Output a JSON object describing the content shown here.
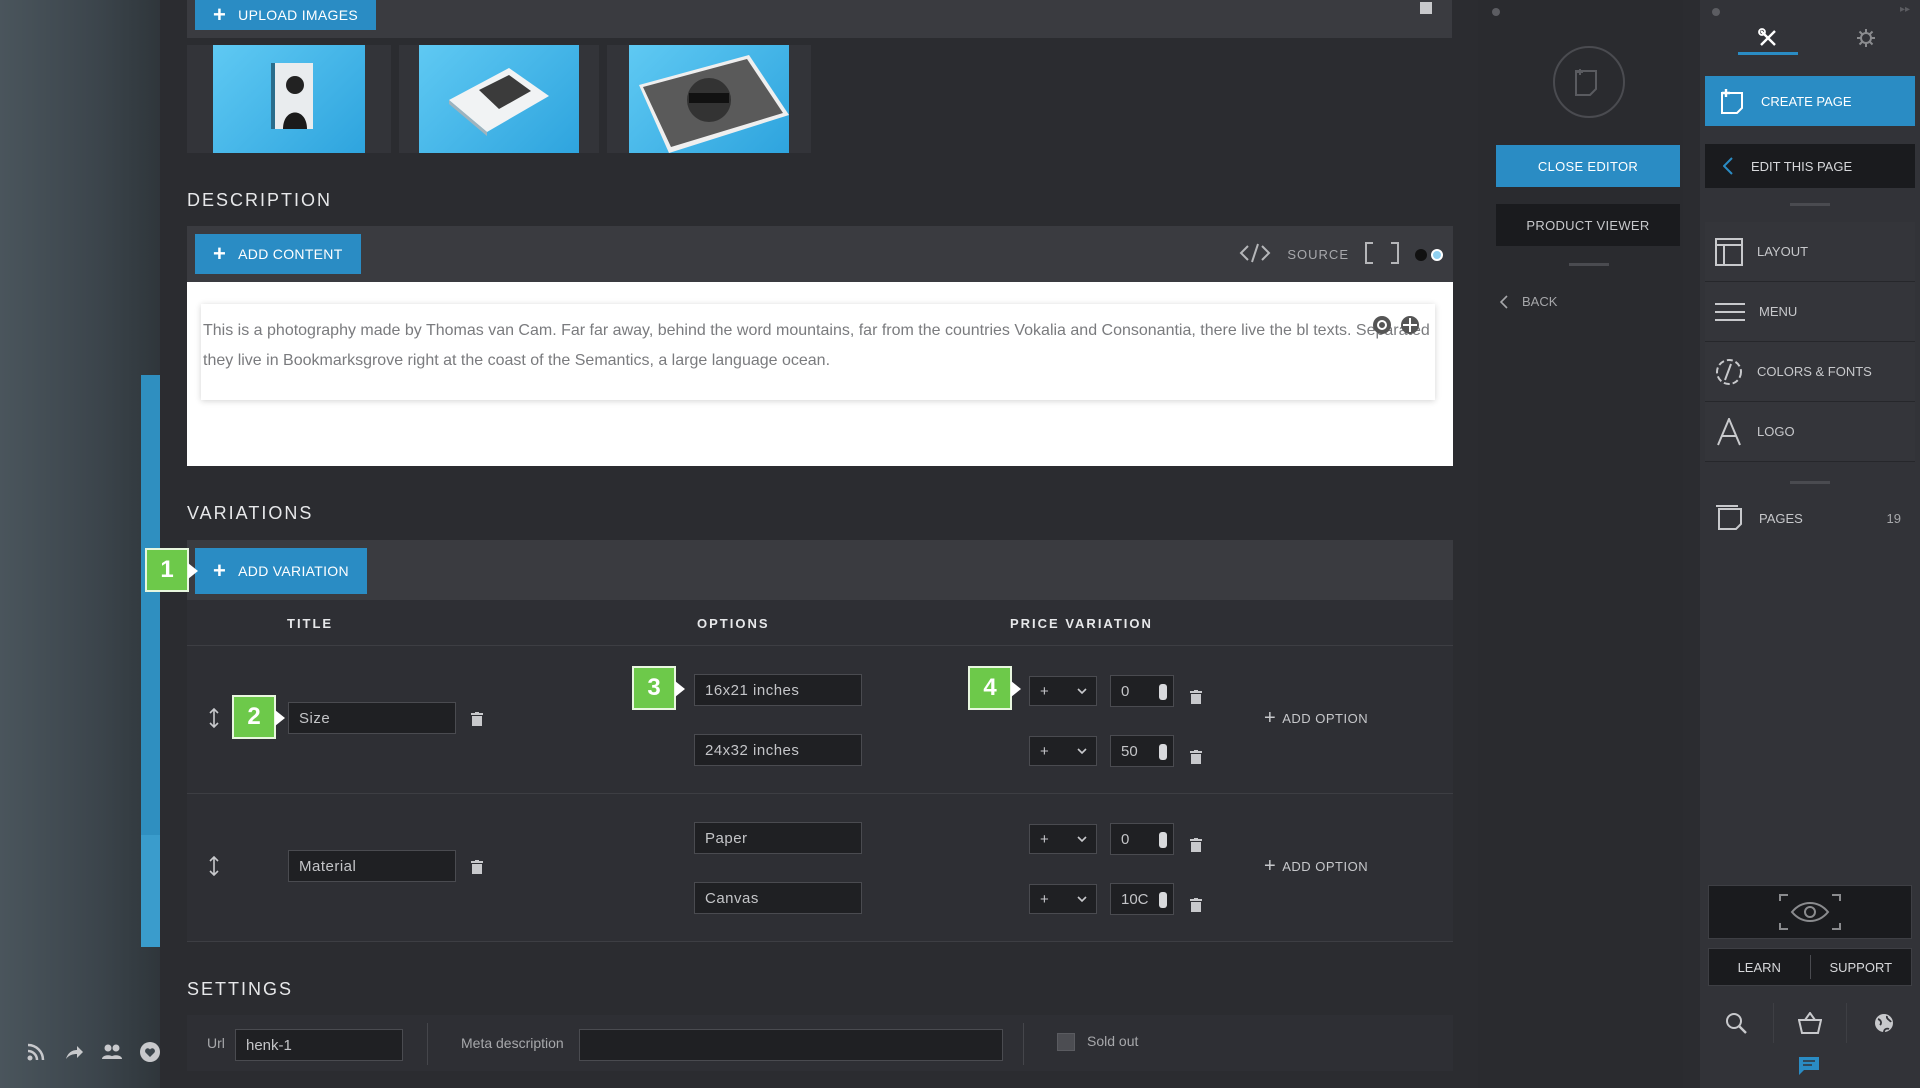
{
  "upload": {
    "label": "UPLOAD IMAGES"
  },
  "description": {
    "title": "DESCRIPTION",
    "add_content": "ADD CONTENT",
    "source": "SOURCE",
    "text": "This is a photography made by Thomas van Cam. Far far away, behind the word mountains, far from the countries Vokalia and Consonantia, there live the bl texts. Separated they live in Bookmarksgrove right at the coast of the Semantics, a large language ocean."
  },
  "variations": {
    "title": "VARIATIONS",
    "add_variation": "ADD VARIATION",
    "headers": {
      "title": "TITLE",
      "options": "OPTIONS",
      "price": "PRICE VARIATION"
    },
    "add_option": "ADD OPTION",
    "rows": [
      {
        "title": "Size",
        "options": [
          {
            "label": "16x21 inches",
            "sign": "+",
            "price": "0"
          },
          {
            "label": "24x32 inches",
            "sign": "+",
            "price": "50"
          }
        ]
      },
      {
        "title": "Material",
        "options": [
          {
            "label": "Paper",
            "sign": "+",
            "price": "0"
          },
          {
            "label": "Canvas",
            "sign": "+",
            "price": "10C"
          }
        ]
      }
    ],
    "badges": [
      "1",
      "2",
      "3",
      "4"
    ]
  },
  "settings": {
    "title": "SETTINGS",
    "url_label": "Url",
    "url_value": "henk-1",
    "meta_label": "Meta description",
    "meta_value": "",
    "sold_out": "Sold out"
  },
  "middle_panel": {
    "close_editor": "CLOSE EDITOR",
    "product_viewer": "PRODUCT VIEWER",
    "back": "BACK"
  },
  "right_panel": {
    "create_page": "CREATE PAGE",
    "edit_this_page": "EDIT THIS PAGE",
    "layout": "LAYOUT",
    "menu": "MENU",
    "colors_fonts": "COLORS & FONTS",
    "logo": "LOGO",
    "pages": "PAGES",
    "pages_count": "19",
    "learn": "LEARN",
    "support": "SUPPORT"
  },
  "colors": {
    "accent": "#2a8cc4",
    "badge": "#6dc94a",
    "panel": "#2b2c30"
  }
}
